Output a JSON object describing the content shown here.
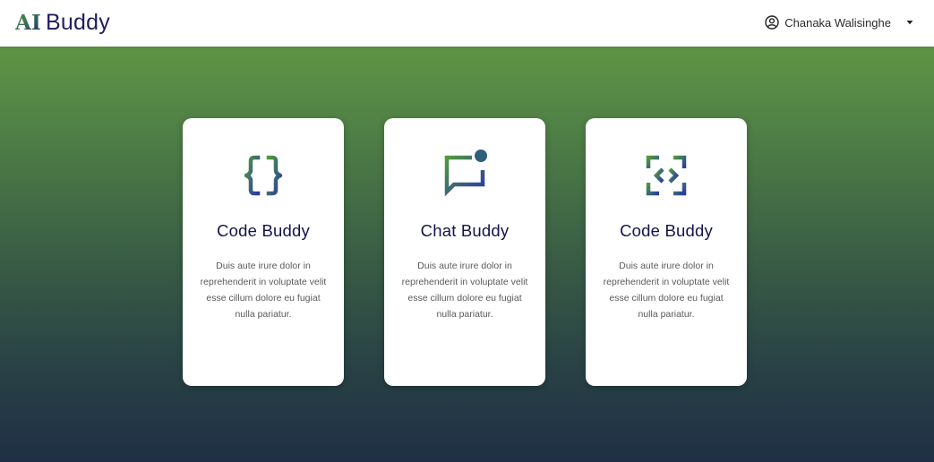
{
  "header": {
    "logo_ai": "AI",
    "logo_name": "Buddy",
    "user_name": "Chanaka Walisinghe"
  },
  "colors": {
    "brand_navy": "#1f1f5c",
    "icon_green": "#4f9a3c",
    "icon_blue": "#2b3aa8",
    "bg_top": "#5f9445",
    "bg_bottom": "#1f2e45"
  },
  "cards": [
    {
      "icon": "curly-braces-icon",
      "title": "Code Buddy",
      "description": "Duis aute irure dolor in reprehenderit in voluptate velit esse cillum dolore eu fugiat nulla pariatur."
    },
    {
      "icon": "chat-notification-icon",
      "title": "Chat Buddy",
      "description": "Duis aute irure dolor in reprehenderit in voluptate velit esse cillum dolore eu fugiat nulla pariatur."
    },
    {
      "icon": "code-brackets-icon",
      "title": "Code Buddy",
      "description": "Duis aute irure dolor in reprehenderit in voluptate velit esse cillum dolore eu fugiat nulla pariatur."
    }
  ]
}
